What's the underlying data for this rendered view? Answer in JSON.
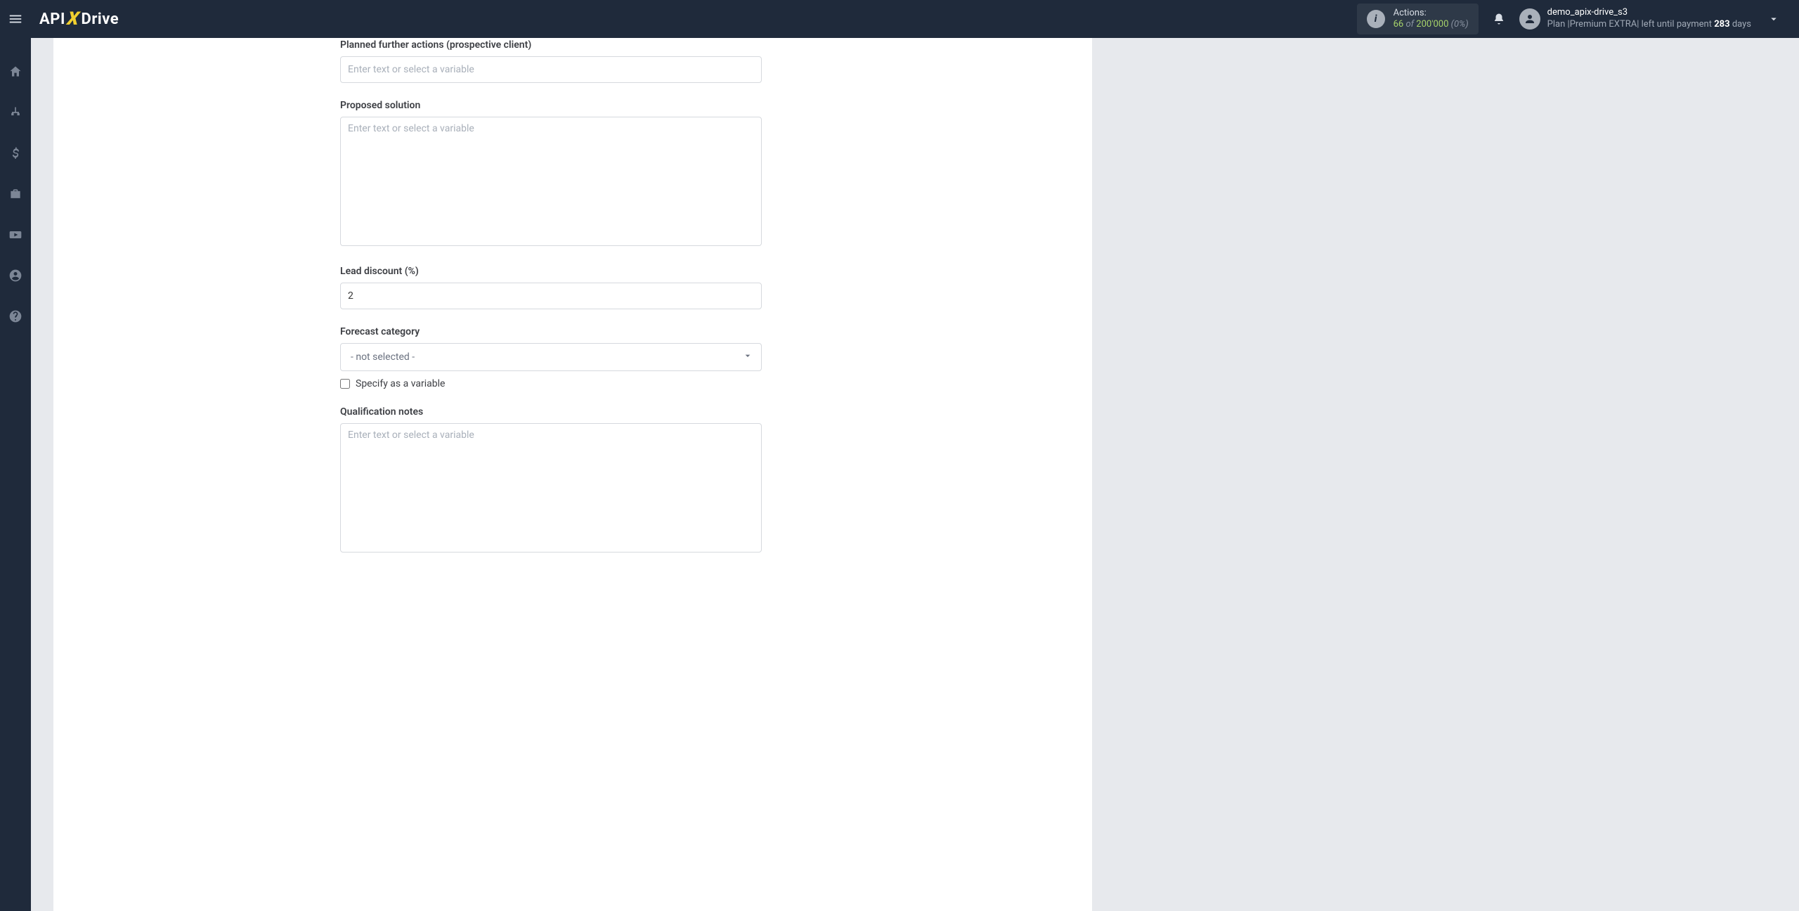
{
  "header": {
    "logo": {
      "part1": "API",
      "part2": "X",
      "part3": "Drive"
    },
    "actions": {
      "label": "Actions:",
      "current": "66",
      "of": "of",
      "max": "200'000",
      "pct": "(0%)"
    },
    "user": {
      "name": "demo_apix-drive_s3",
      "plan_prefix": "Plan  |",
      "plan_name": "Premium EXTRA",
      "plan_mid": "|  left until payment ",
      "days_count": "283",
      "days_suffix": " days"
    }
  },
  "form": {
    "planned": {
      "label": "Planned further actions (prospective client)",
      "placeholder": "Enter text or select a variable",
      "value": ""
    },
    "solution": {
      "label": "Proposed solution",
      "placeholder": "Enter text or select a variable",
      "value": ""
    },
    "discount": {
      "label": "Lead discount (%)",
      "value": "2"
    },
    "forecast": {
      "label": "Forecast category",
      "selected": "- not selected -",
      "specify_label": "Specify as a variable"
    },
    "qualnotes": {
      "label": "Qualification notes",
      "placeholder": "Enter text or select a variable",
      "value": ""
    }
  }
}
